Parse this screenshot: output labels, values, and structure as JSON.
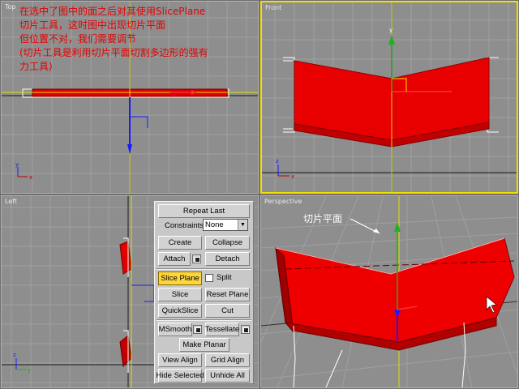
{
  "caption": {
    "line1": "在选中了图中的面之后对其使用SlicePlane",
    "line2": "切片工具，这时图中出现切片平面",
    "line3": "但位置不对，我们需要调节",
    "line4": "(切片工具是利用切片平面切割多边形的强有",
    "line5": "力工具)"
  },
  "viewports": {
    "top": {
      "label": "Top"
    },
    "front": {
      "label": "Front"
    },
    "left": {
      "label": "Left"
    },
    "perspective": {
      "label": "Perspective"
    }
  },
  "annotation": {
    "text": "切片平面"
  },
  "edit_geometry": {
    "repeat_last": "Repeat Last",
    "constraints_label": "Constraints:",
    "constraints_value": "None",
    "create": "Create",
    "collapse": "Collapse",
    "attach": "Attach",
    "detach": "Detach",
    "slice_plane": "Slice Plane",
    "split": "Split",
    "slice": "Slice",
    "reset_plane": "Reset Plane",
    "quickslice": "QuickSlice",
    "cut": "Cut",
    "msmooth": "MSmooth",
    "tessellate": "Tessellate",
    "make_planar": "Make Planar",
    "view_align": "View Align",
    "grid_align": "Grid Align",
    "hide_selected": "Hide Selected",
    "unhide_all": "Unhide All"
  },
  "colors": {
    "selection_red": "#ff0000",
    "slice_plane_yellow": "#f0e000",
    "active_button": "#fcd63c"
  }
}
